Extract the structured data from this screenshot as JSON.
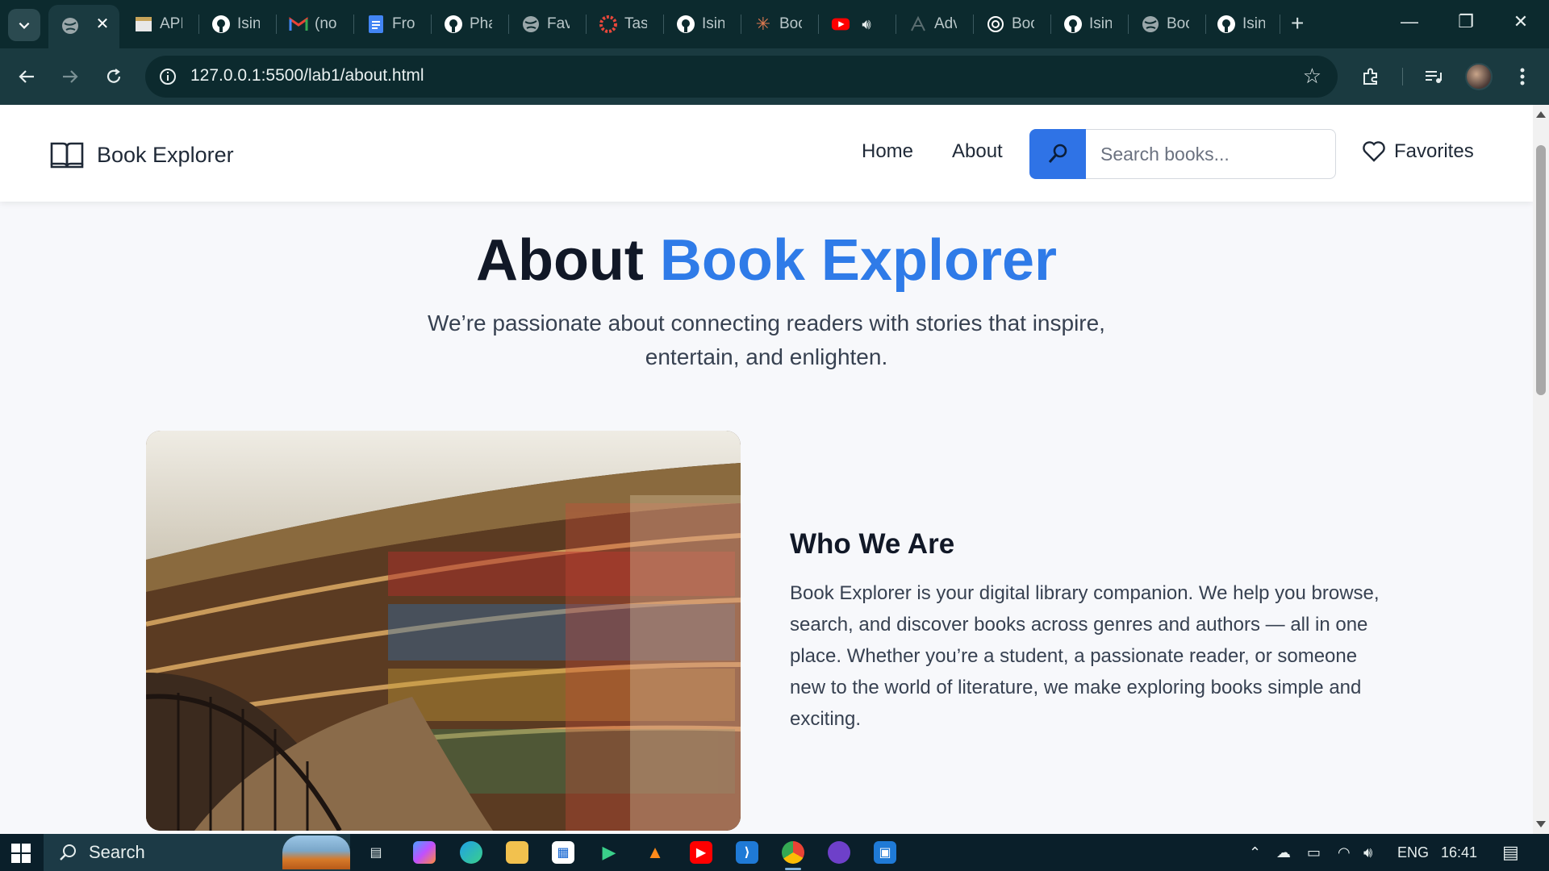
{
  "browser": {
    "tabs": [
      {
        "name": "api",
        "label": "API",
        "icon": "api-doc-icon"
      },
      {
        "name": "github-1",
        "label": "Isin",
        "icon": "github-icon"
      },
      {
        "name": "gmail",
        "label": "(no",
        "icon": "gmail-icon"
      },
      {
        "name": "docs",
        "label": "Fro",
        "icon": "docs-icon"
      },
      {
        "name": "github-2",
        "label": "Pha",
        "icon": "github-icon"
      },
      {
        "name": "globe-1",
        "label": "Fav",
        "icon": "globe-icon"
      },
      {
        "name": "tasks",
        "label": "Tas",
        "icon": "tasks-icon"
      },
      {
        "name": "github-3",
        "label": "Isin",
        "icon": "github-icon"
      },
      {
        "name": "claude",
        "label": "Boo",
        "icon": "claude-icon"
      },
      {
        "name": "advisor",
        "label": "Adv",
        "icon": "perplexity-icon"
      },
      {
        "name": "chatgpt",
        "label": "Boo",
        "icon": "chatgpt-icon"
      },
      {
        "name": "github-4",
        "label": "Isin",
        "icon": "github-icon"
      },
      {
        "name": "globe-2",
        "label": "Boo",
        "icon": "globe-icon"
      },
      {
        "name": "github-5",
        "label": "Isin",
        "icon": "github-icon"
      }
    ],
    "url": "127.0.0.1:5500/lab1/about.html"
  },
  "site": {
    "brand": "Book Explorer",
    "nav": {
      "home": "Home",
      "about": "About",
      "favorites": "Favorites"
    },
    "search_placeholder": "Search books..."
  },
  "hero": {
    "title_prefix": "About",
    "title_accent": "Book Explorer",
    "subtitle": "We’re passionate about connecting readers with stories that inspire, entertain, and enlighten."
  },
  "about": {
    "heading": "Who We Are",
    "paragraph": "Book Explorer is your digital library companion. We help you browse, search, and discover books across genres and authors — all in one place. Whether you’re a student, a passionate reader, or someone new to the world of literature, we make exploring books simple and exciting."
  },
  "taskbar": {
    "search_label": "Search",
    "language": "ENG",
    "time": "16:41"
  },
  "colors": {
    "accent": "#2f7be8",
    "search_button": "#2f73e6"
  }
}
